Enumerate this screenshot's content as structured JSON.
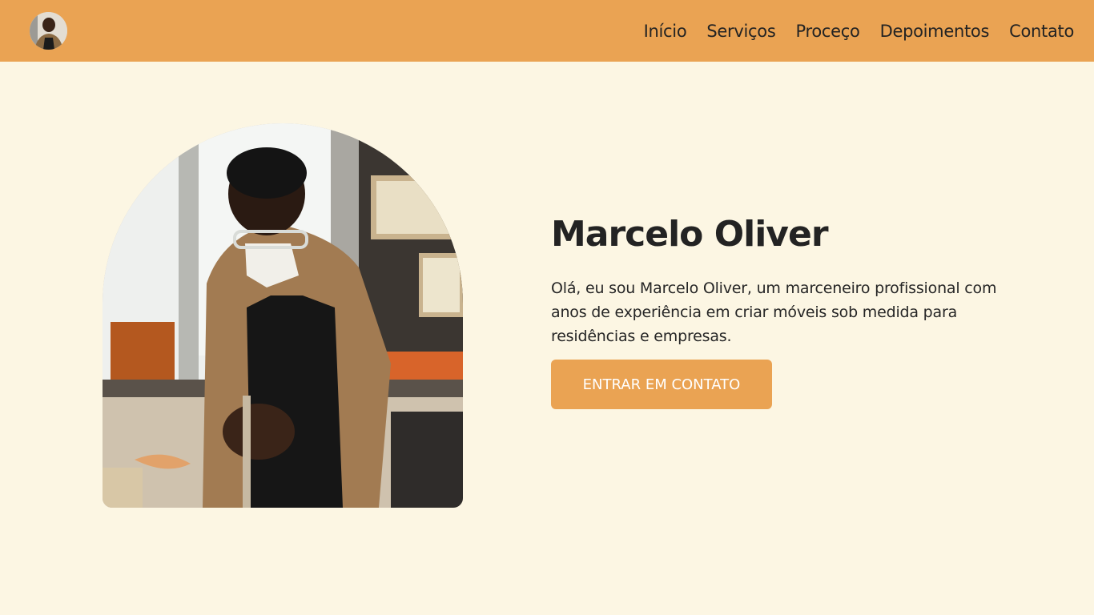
{
  "nav": {
    "logo_alt": "avatar",
    "links": [
      "Início",
      "Serviços",
      "Proceço",
      "Depoimentos",
      "Contato"
    ]
  },
  "hero": {
    "title": "Marcelo Oliver",
    "description": "Olá, eu sou Marcelo Oliver, um marceneiro profissional com anos de experiência em criar móveis sob medida para residências e empresas.",
    "cta_label": "ENTRAR EM CONTATO",
    "photo": "carpenter-at-workbench-photo"
  },
  "colors": {
    "accent": "#eaa353",
    "background": "#fcf6e3",
    "text": "#232323"
  }
}
